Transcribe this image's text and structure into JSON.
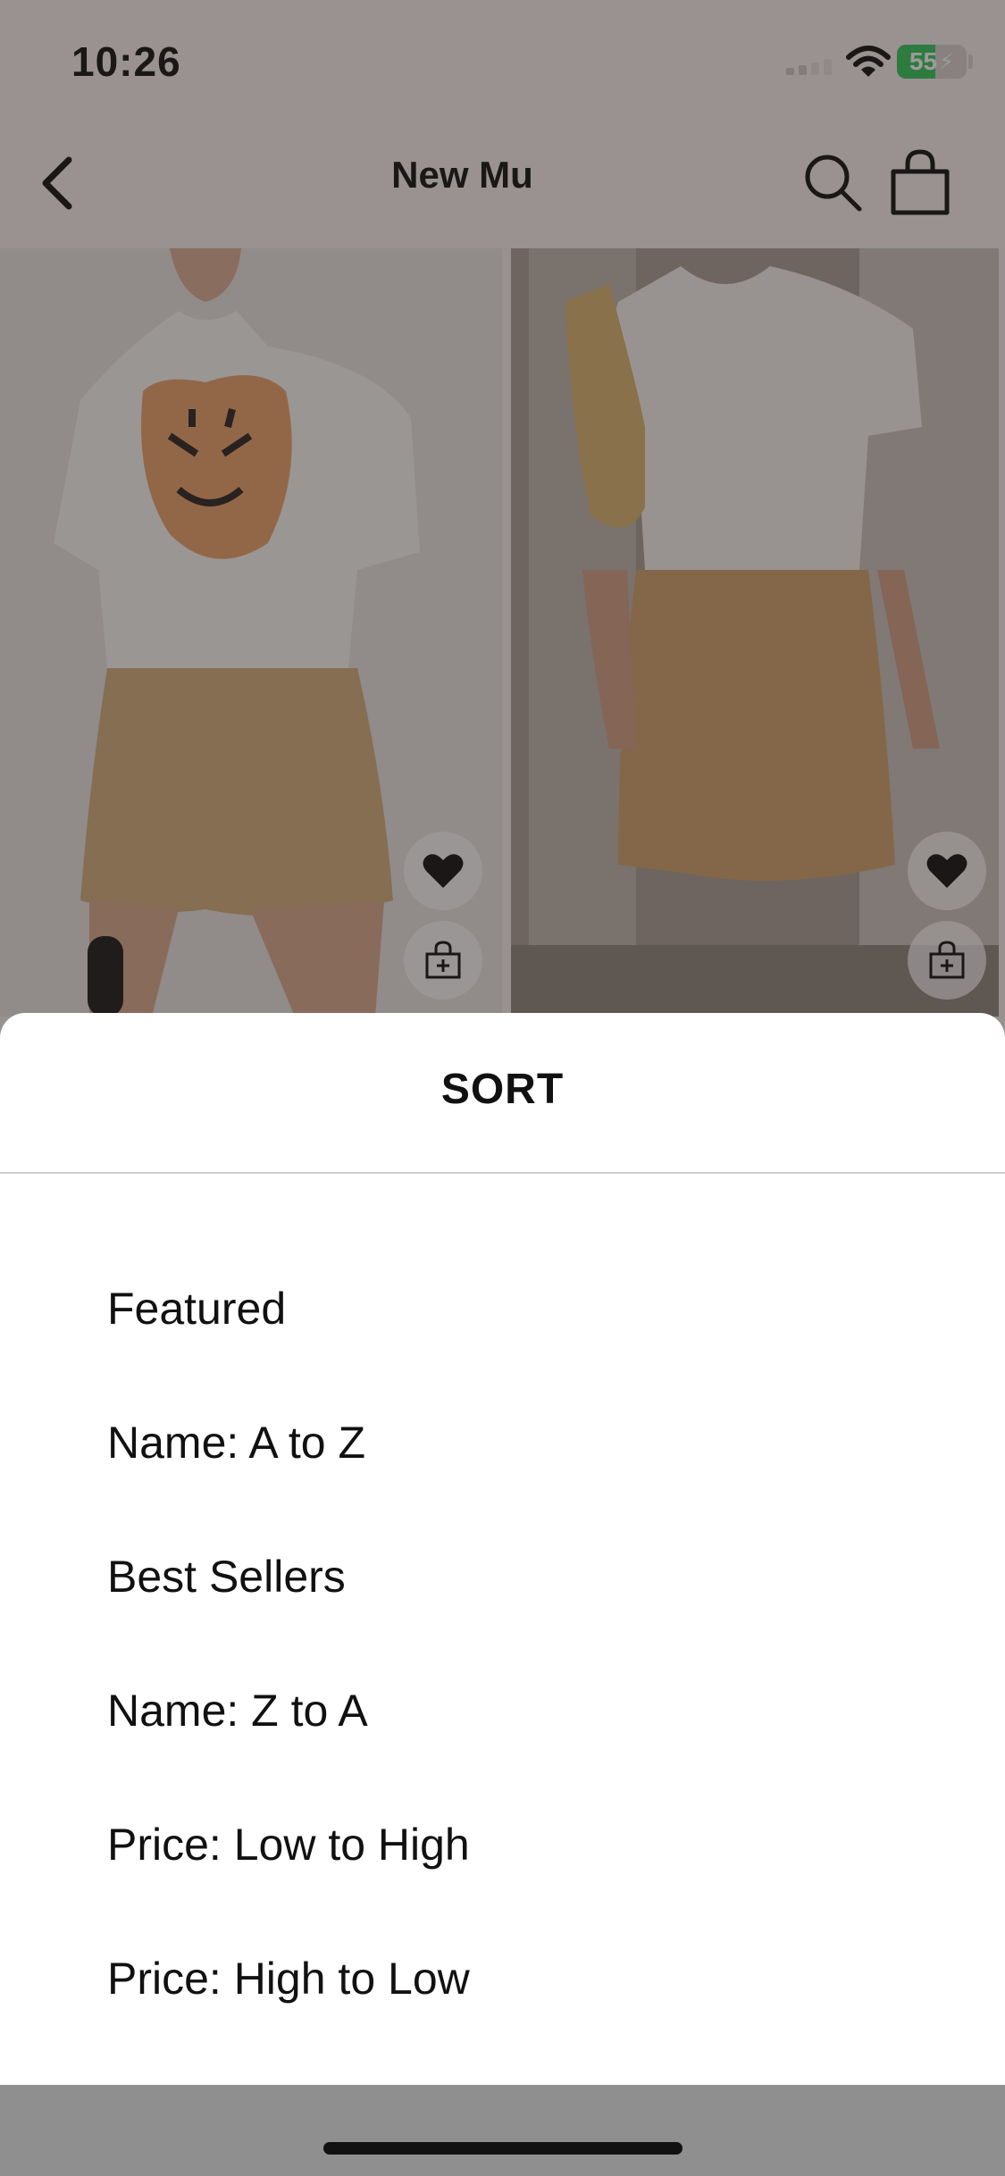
{
  "status_bar": {
    "time": "10:26",
    "battery_level": "55",
    "battery_fraction": 0.55,
    "icons": [
      "cellular-signal-icon",
      "wifi-icon",
      "battery-charging-icon"
    ]
  },
  "nav": {
    "title": "New Mu",
    "icons": [
      "chevron-left-icon",
      "search-icon",
      "shopping-bag-icon"
    ]
  },
  "products": [
    {
      "image_subject": "tiger graphic tee with satin mini skirt",
      "icons": [
        "heart-icon",
        "add-to-bag-icon"
      ]
    },
    {
      "image_subject": "white crop tee with satin mini skirt and shoulder bag",
      "icons": [
        "heart-icon",
        "add-to-bag-icon"
      ]
    }
  ],
  "sort_sheet": {
    "title": "SORT",
    "options": [
      "Featured",
      "Name: A to Z",
      "Best Sellers",
      "Name: Z to A",
      "Price: Low to High",
      "Price: High to Low"
    ]
  },
  "colors": {
    "scrim": "#281e1e",
    "battery_fill": "#34c759",
    "sheet_background": "#ffffff",
    "text": "#111111"
  }
}
